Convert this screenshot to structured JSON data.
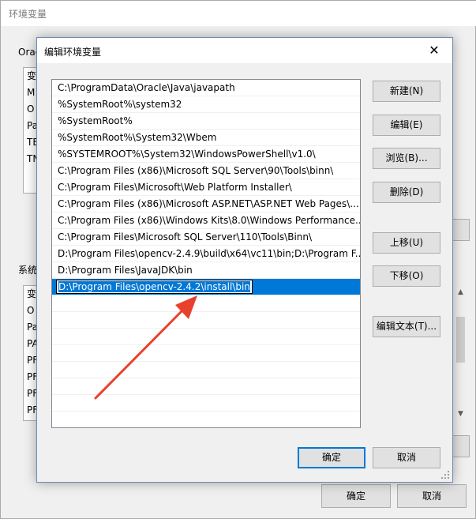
{
  "background_window": {
    "title": "环境变量",
    "user_group_label": "Orac",
    "user_rows": [
      "变",
      "M",
      "O",
      "Pa",
      "TE",
      "TN"
    ],
    "system_group_label": "系统",
    "system_rows": [
      "变",
      "O",
      "Pa",
      "PA",
      "PF",
      "PF",
      "PF",
      "PF"
    ],
    "ok_label": "确定",
    "cancel_label": "取消"
  },
  "dialog": {
    "title": "编辑环境变量",
    "close_glyph": "✕",
    "paths": [
      "C:\\ProgramData\\Oracle\\Java\\javapath",
      "%SystemRoot%\\system32",
      "%SystemRoot%",
      "%SystemRoot%\\System32\\Wbem",
      "%SYSTEMROOT%\\System32\\WindowsPowerShell\\v1.0\\",
      "C:\\Program Files (x86)\\Microsoft SQL Server\\90\\Tools\\binn\\",
      "C:\\Program Files\\Microsoft\\Web Platform Installer\\",
      "C:\\Program Files (x86)\\Microsoft ASP.NET\\ASP.NET Web Pages\\...",
      "C:\\Program Files (x86)\\Windows Kits\\8.0\\Windows Performance...",
      "C:\\Program Files\\Microsoft SQL Server\\110\\Tools\\Binn\\",
      "D:\\Program Files\\opencv-2.4.9\\build\\x64\\vc11\\bin;D:\\Program F...",
      "D:\\Program Files\\JavaJDK\\bin"
    ],
    "editing_value": "D:\\Program Files\\opencv-2.4.2\\install\\bin",
    "buttons": {
      "new": "新建(N)",
      "edit": "编辑(E)",
      "browse": "浏览(B)...",
      "delete": "删除(D)",
      "move_up": "上移(U)",
      "move_down": "下移(O)",
      "edit_text": "编辑文本(T)..."
    },
    "ok_label": "确定",
    "cancel_label": "取消"
  },
  "colors": {
    "selection": "#0078d7",
    "annotation_arrow": "#e8412c"
  }
}
